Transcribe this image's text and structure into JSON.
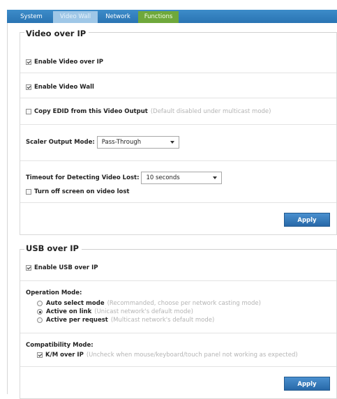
{
  "tabs": [
    "System",
    "Video Wall",
    "Network",
    "Functions"
  ],
  "video_over_ip": {
    "legend": "Video over IP",
    "enable_video_over_ip": {
      "label": "Enable Video over IP",
      "checked": true
    },
    "enable_video_wall": {
      "label": "Enable Video Wall",
      "checked": true
    },
    "copy_edid": {
      "label": "Copy EDID from this Video Output",
      "hint": "(Default disabled under multicast mode)",
      "checked": false
    },
    "scaler_output_mode": {
      "label": "Scaler Output Mode:",
      "value": "Pass-Through"
    },
    "timeout_video_lost": {
      "label": "Timeout for Detecting Video Lost:",
      "value": "10 seconds"
    },
    "turn_off_screen": {
      "label": "Turn off screen on video lost",
      "checked": false
    },
    "apply_label": "Apply"
  },
  "usb_over_ip": {
    "legend": "USB over IP",
    "enable_usb_over_ip": {
      "label": "Enable USB over IP",
      "checked": true
    },
    "operation_mode": {
      "heading": "Operation Mode:",
      "options": [
        {
          "label": "Auto select mode",
          "hint": "(Recommanded, choose per network casting mode)",
          "selected": false
        },
        {
          "label": "Active on link",
          "hint": "(Unicast network's default mode)",
          "selected": true
        },
        {
          "label": "Active per request",
          "hint": "(Multicast network's default mode)",
          "selected": false
        }
      ]
    },
    "compatibility_mode": {
      "heading": "Compatibility Mode:",
      "km_over_ip": {
        "label": "K/M over IP",
        "hint": "(Uncheck when mouse/keyboard/touch panel not working as expected)",
        "checked": true
      }
    },
    "apply_label": "Apply"
  }
}
